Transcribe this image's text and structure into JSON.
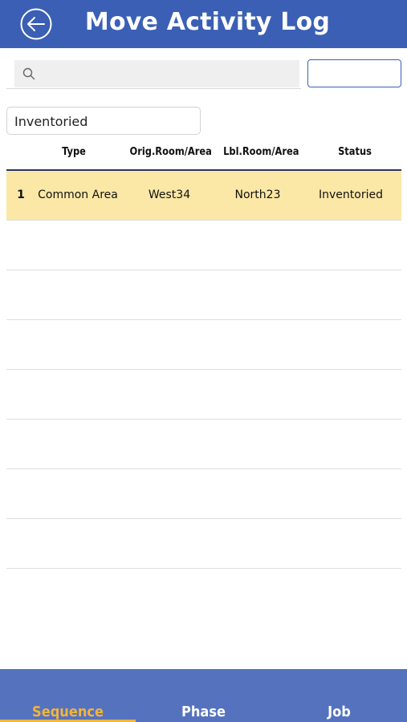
{
  "header": {
    "title": "Move Activity Log",
    "back_icon": "back-arrow-circle-icon"
  },
  "search": {
    "value": "",
    "placeholder": "",
    "icon": "search-icon"
  },
  "filter_input": {
    "value": "",
    "placeholder": ""
  },
  "status_filter": {
    "selected": "Inventoried"
  },
  "table": {
    "columns": [
      "Type",
      "Orig.Room/Area",
      "Lbl.Room/Area",
      "Status"
    ],
    "rows": [
      {
        "number": "1",
        "type": "Common Area",
        "orig_room": "West34",
        "lbl_room": "North23",
        "status": "Inventoried",
        "selected": true
      }
    ]
  },
  "bottom_nav": {
    "tabs": [
      {
        "label": "Sequence",
        "active": true
      },
      {
        "label": "Phase",
        "active": false
      },
      {
        "label": "Job",
        "active": false
      }
    ]
  },
  "colors": {
    "header_bg": "#3a5fb5",
    "nav_bg": "#5572bf",
    "accent": "#f2b43a",
    "selected_row": "#fbe8a6"
  }
}
